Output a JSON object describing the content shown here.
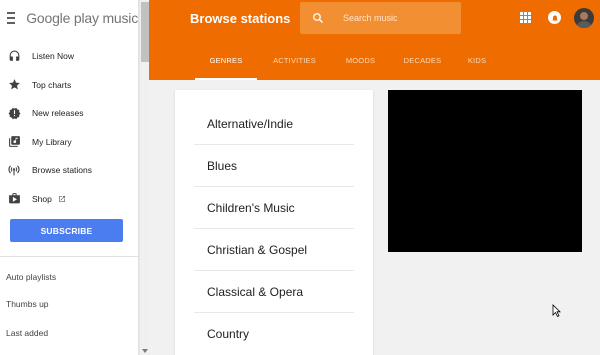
{
  "app": {
    "logo_text": "Google play music"
  },
  "sidebar": {
    "items": [
      {
        "label": "Listen Now",
        "icon": "headphones-icon"
      },
      {
        "label": "Top charts",
        "icon": "star-icon"
      },
      {
        "label": "New releases",
        "icon": "new-releases-icon"
      },
      {
        "label": "My Library",
        "icon": "library-icon"
      },
      {
        "label": "Browse stations",
        "icon": "radio-icon"
      },
      {
        "label": "Shop",
        "icon": "shop-icon"
      }
    ],
    "subscribe_label": "SUBSCRIBE",
    "playlists": [
      "Auto playlists",
      "Thumbs up",
      "Last added"
    ]
  },
  "header": {
    "title": "Browse stations",
    "search_placeholder": "Search music",
    "accent_color": "#ef6c00",
    "tabs": [
      "GENRES",
      "ACTIVITIES",
      "MOODS",
      "DECADES",
      "KIDS"
    ],
    "active_tab": "GENRES"
  },
  "genres": [
    "Alternative/Indie",
    "Blues",
    "Children's Music",
    "Christian & Gospel",
    "Classical & Opera",
    "Country"
  ]
}
